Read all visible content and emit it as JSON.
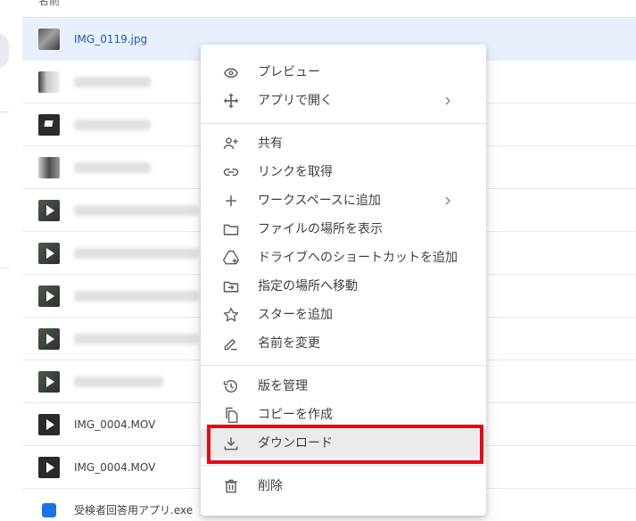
{
  "list_header": {
    "name_column": "名前"
  },
  "files": [
    {
      "name": "IMG_0119.jpg",
      "thumb": "photo",
      "selected": true,
      "blurred": false
    },
    {
      "name": "",
      "thumb": "photo2",
      "selected": false,
      "blurred": true,
      "blur_width": 86
    },
    {
      "name": "",
      "thumb": "photo3",
      "selected": false,
      "blurred": true,
      "blur_width": 86
    },
    {
      "name": "",
      "thumb": "photo4",
      "selected": false,
      "blurred": true,
      "blur_width": 86
    },
    {
      "name": "",
      "thumb": "video",
      "selected": false,
      "blurred": true,
      "blur_width": 140
    },
    {
      "name": "",
      "thumb": "video",
      "selected": false,
      "blurred": true,
      "blur_width": 140
    },
    {
      "name": "",
      "thumb": "video",
      "selected": false,
      "blurred": true,
      "blur_width": 140
    },
    {
      "name": "",
      "thumb": "video",
      "selected": false,
      "blurred": true,
      "blur_width": 140
    },
    {
      "name": "",
      "thumb": "video",
      "selected": false,
      "blurred": true,
      "blur_width": 100
    },
    {
      "name": "IMG_0004.MOV",
      "thumb": "video",
      "selected": false,
      "blurred": false
    },
    {
      "name": "IMG_0004.MOV",
      "thumb": "video",
      "selected": false,
      "blurred": false
    },
    {
      "name": "受検者回答用アプリ.exe",
      "thumb": "app",
      "selected": false,
      "blurred": false
    }
  ],
  "context_menu": {
    "items": [
      {
        "id": "preview",
        "label": "プレビュー",
        "icon": "eye-icon",
        "submenu": false
      },
      {
        "id": "open-with",
        "label": "アプリで開く",
        "icon": "move-icon",
        "submenu": true
      },
      {
        "id": "share",
        "label": "共有",
        "icon": "person-add-icon",
        "submenu": false
      },
      {
        "id": "get-link",
        "label": "リンクを取得",
        "icon": "link-icon",
        "submenu": false
      },
      {
        "id": "add-workspace",
        "label": "ワークスペースに追加",
        "icon": "plus-icon",
        "submenu": true
      },
      {
        "id": "show-location",
        "label": "ファイルの場所を表示",
        "icon": "folder-icon",
        "submenu": false
      },
      {
        "id": "add-shortcut",
        "label": "ドライブへのショートカットを追加",
        "icon": "drive-shortcut-icon",
        "submenu": false
      },
      {
        "id": "move-to",
        "label": "指定の場所へ移動",
        "icon": "folder-move-icon",
        "submenu": false
      },
      {
        "id": "add-star",
        "label": "スターを追加",
        "icon": "star-icon",
        "submenu": false
      },
      {
        "id": "rename",
        "label": "名前を変更",
        "icon": "pencil-icon",
        "submenu": false
      },
      {
        "id": "manage-versions",
        "label": "版を管理",
        "icon": "history-icon",
        "submenu": false
      },
      {
        "id": "make-copy",
        "label": "コピーを作成",
        "icon": "copy-icon",
        "submenu": false
      },
      {
        "id": "download",
        "label": "ダウンロード",
        "icon": "download-icon",
        "submenu": false,
        "highlighted": true
      },
      {
        "id": "delete",
        "label": "削除",
        "icon": "trash-icon",
        "submenu": false
      }
    ]
  },
  "colors": {
    "selected_row_bg": "#e8f0fe",
    "selected_row_text": "#1a57c5",
    "highlight_box": "#e50914"
  }
}
